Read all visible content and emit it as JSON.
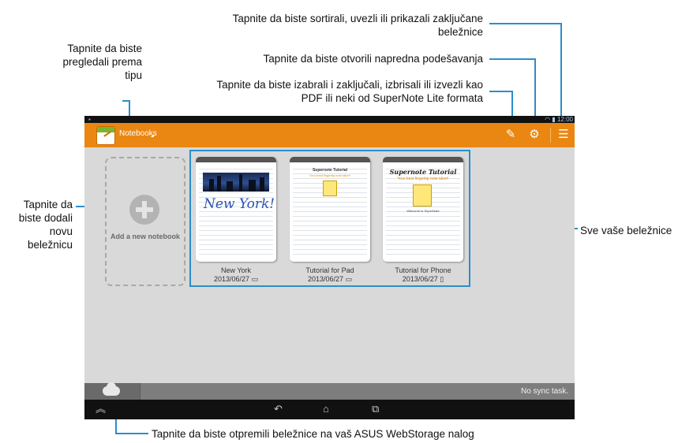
{
  "callouts": {
    "sort_import": "Tapnite da biste sortirali, uvezli ili prikazali zaključane beležnice",
    "settings": "Tapnite da biste otvorili napredna podešavanja",
    "select_lock": "Tapnite da biste izabrali i zaključali, izbrisali ili izvezli kao PDF ili neki od SuperNote Lite formata",
    "view_by_type": "Tapnite da biste pregledali prema tipu",
    "add_notebook": "Tapnite da biste dodali novu beležnicu",
    "all_notebooks": "Sve vaše beležnice",
    "upload": "Tapnite da biste otpremili beležnice na vaš ASUS WebStorage nalog"
  },
  "status_bar": {
    "time": "12:00"
  },
  "action_bar": {
    "notebooks_label": "Notebooks",
    "icons": [
      "select-edit-icon",
      "settings-gear-icon",
      "overflow-menu-icon"
    ]
  },
  "add_notebook_label": "Add a new notebook",
  "notebooks": [
    {
      "name": "New York",
      "date": "2013/06/27",
      "type_icon": "pad-icon",
      "handwriting": "New York!"
    },
    {
      "name": "Tutorial for Pad",
      "date": "2013/06/27",
      "type_icon": "pad-icon",
      "title": "Supernote Tutorial",
      "subtitle": "Your best fingertip note taker!"
    },
    {
      "name": "Tutorial for Phone",
      "date": "2013/06/27",
      "type_icon": "phone-icon",
      "title": "Supernote Tutorial",
      "subtitle": "Your best fingertip note taker!",
      "welcome": "Welcome to SuperNote"
    }
  ],
  "bottom_bar": {
    "sync_status": "No sync task."
  },
  "nav_bar": {
    "icons": [
      "up-chevron-icon",
      "back-icon",
      "home-icon",
      "recent-apps-icon"
    ]
  },
  "colors": {
    "accent_orange": "#ea8712",
    "callout_blue": "#2a8fc9"
  }
}
